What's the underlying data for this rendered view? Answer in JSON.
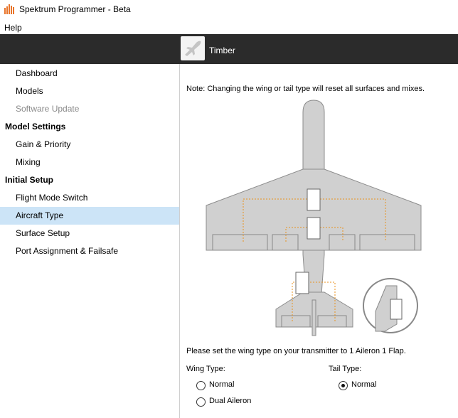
{
  "window": {
    "title": "Spektrum Programmer - Beta"
  },
  "menu": {
    "help": "Help"
  },
  "model": {
    "name": "Timber",
    "icon": "airplane-icon"
  },
  "sidebar": {
    "items": [
      {
        "label": "Dashboard",
        "kind": "item"
      },
      {
        "label": "Models",
        "kind": "item"
      },
      {
        "label": "Software Update",
        "kind": "item-disabled"
      },
      {
        "label": "Model Settings",
        "kind": "header"
      },
      {
        "label": "Gain & Priority",
        "kind": "item"
      },
      {
        "label": "Mixing",
        "kind": "item"
      },
      {
        "label": "Initial Setup",
        "kind": "header"
      },
      {
        "label": "Flight Mode Switch",
        "kind": "item"
      },
      {
        "label": "Aircraft Type",
        "kind": "item-active"
      },
      {
        "label": "Surface Setup",
        "kind": "item"
      },
      {
        "label": "Port Assignment & Failsafe",
        "kind": "item"
      }
    ]
  },
  "content": {
    "note": "Note: Changing the wing or tail type will reset all surfaces and mixes.",
    "instruction": "Please set the wing type on your transmitter to 1 Aileron 1 Flap.",
    "wing_type": {
      "label": "Wing Type:",
      "options": [
        {
          "label": "Normal",
          "checked": false
        },
        {
          "label": "Dual Aileron",
          "checked": false
        }
      ]
    },
    "tail_type": {
      "label": "Tail Type:",
      "options": [
        {
          "label": "Normal",
          "checked": true
        }
      ]
    }
  },
  "colors": {
    "model_bar": "#2b2b2b",
    "sidebar_active": "#cce4f7",
    "aircraft_fill": "#d0d0d0",
    "aircraft_stroke": "#8c8c8c",
    "wire": "#e8921e",
    "app_icon": "#e8742a"
  }
}
